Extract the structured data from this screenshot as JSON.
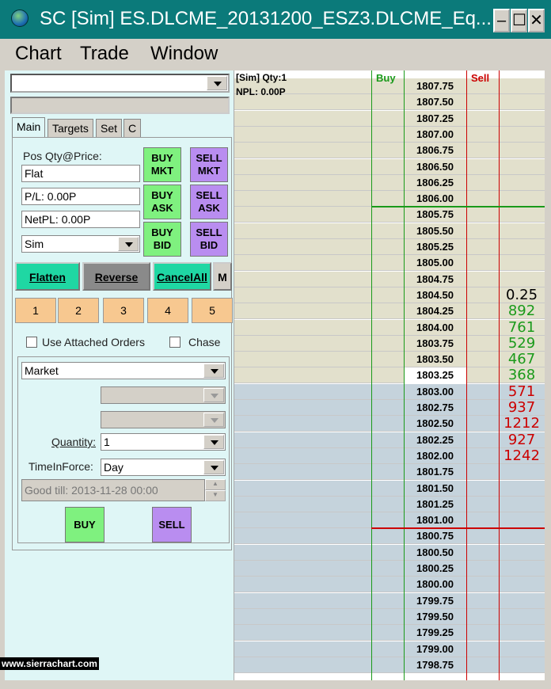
{
  "window": {
    "title": "SC [Sim] ES.DLCME_20131200_ESZ3.DLCME_Eq...",
    "minimize": "–",
    "maximize": "☐",
    "close": "✕"
  },
  "menu": [
    "Chart",
    "Trade",
    "Window"
  ],
  "top_combo_value": "",
  "tabs": [
    "Main",
    "Targets",
    "Set",
    "C"
  ],
  "position": {
    "label": "Pos Qty@Price:",
    "value": "Flat",
    "pl": "P/L: 0.00P",
    "netpl": "NetPL: 0.00P",
    "account": "Sim"
  },
  "quick_buttons": {
    "buy_mkt": [
      "BUY",
      "MKT"
    ],
    "sell_mkt": [
      "SELL",
      "MKT"
    ],
    "buy_ask": [
      "BUY",
      "ASK"
    ],
    "sell_ask": [
      "SELL",
      "ASK"
    ],
    "buy_bid": [
      "BUY",
      "BID"
    ],
    "sell_bid": [
      "SELL",
      "BID"
    ]
  },
  "actions": {
    "flatten": "Flatten",
    "reverse": "Reverse",
    "cancel_all": "CancelAll",
    "more": "M"
  },
  "quantity_presets": [
    "1",
    "2",
    "3",
    "4",
    "5"
  ],
  "options": {
    "attached": "Use Attached Orders",
    "chase": "Chase"
  },
  "order": {
    "type": "Market",
    "quantity_label": "Quantity:",
    "quantity": "1",
    "tif_label": "TimeInForce:",
    "tif": "Day",
    "good_till": "Good till: 2013-11-28 00:00",
    "buy": "BUY",
    "sell": "SELL"
  },
  "watermark": "www.sierrachart.com",
  "dom": {
    "info1": "[Sim]  Qty:1",
    "info2": "NPL: 0.00P",
    "buy_header": "Buy",
    "sell_header": "Sell",
    "colors": {
      "upper_bg": "#e2e0cc",
      "lower_bg": "#c5d3dc",
      "current_bg": "#ffffff",
      "buy_color": "#1a9a1a",
      "sell_color": "#c00000"
    },
    "rows": [
      {
        "price": "1807.75",
        "sell": "",
        "buy": ""
      },
      {
        "price": "1807.50",
        "sell": "",
        "buy": ""
      },
      {
        "price": "1807.25",
        "sell": "",
        "buy": ""
      },
      {
        "price": "1807.00",
        "sell": "",
        "buy": ""
      },
      {
        "price": "1806.75",
        "sell": "",
        "buy": ""
      },
      {
        "price": "1806.50",
        "sell": "",
        "buy": ""
      },
      {
        "price": "1806.25",
        "sell": "",
        "buy": ""
      },
      {
        "price": "1806.00",
        "sell": "",
        "buy": ""
      },
      {
        "price": "1805.75",
        "sell": "",
        "buy": ""
      },
      {
        "price": "1805.50",
        "sell": "",
        "buy": ""
      },
      {
        "price": "1805.25",
        "sell": "",
        "buy": ""
      },
      {
        "price": "1805.00",
        "sell": "",
        "buy": ""
      },
      {
        "price": "1804.75",
        "sell": "",
        "buy": ""
      },
      {
        "price": "1804.50",
        "sell": "",
        "buy": "0.25"
      },
      {
        "price": "1804.25",
        "sell": "",
        "buy": "892"
      },
      {
        "price": "1804.00",
        "sell": "",
        "buy": "761"
      },
      {
        "price": "1803.75",
        "sell": "",
        "buy": "529"
      },
      {
        "price": "1803.50",
        "sell": "",
        "buy": "467"
      },
      {
        "price": "1803.25",
        "sell": "",
        "buy": "368"
      },
      {
        "price": "1803.00",
        "sell": "571",
        "buy": ""
      },
      {
        "price": "1802.75",
        "sell": "937",
        "buy": ""
      },
      {
        "price": "1802.50",
        "sell": "1212",
        "buy": ""
      },
      {
        "price": "1802.25",
        "sell": "927",
        "buy": ""
      },
      {
        "price": "1802.00",
        "sell": "1242",
        "buy": ""
      },
      {
        "price": "1801.75",
        "sell": "",
        "buy": ""
      },
      {
        "price": "1801.50",
        "sell": "",
        "buy": ""
      },
      {
        "price": "1801.25",
        "sell": "",
        "buy": ""
      },
      {
        "price": "1801.00",
        "sell": "",
        "buy": ""
      },
      {
        "price": "1800.75",
        "sell": "",
        "buy": ""
      },
      {
        "price": "1800.50",
        "sell": "",
        "buy": ""
      },
      {
        "price": "1800.25",
        "sell": "",
        "buy": ""
      },
      {
        "price": "1800.00",
        "sell": "",
        "buy": ""
      },
      {
        "price": "1799.75",
        "sell": "",
        "buy": ""
      },
      {
        "price": "1799.50",
        "sell": "",
        "buy": ""
      },
      {
        "price": "1799.25",
        "sell": "",
        "buy": ""
      },
      {
        "price": "1799.00",
        "sell": "",
        "buy": ""
      },
      {
        "price": "1798.75",
        "sell": "",
        "buy": ""
      }
    ]
  }
}
